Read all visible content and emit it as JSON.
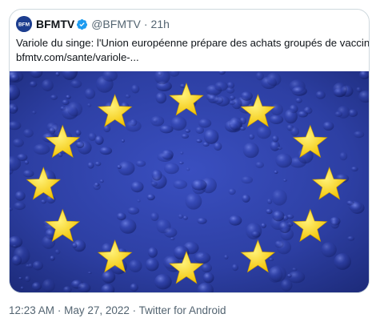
{
  "quote": {
    "display_name": "BFMTV",
    "handle": "@BFMTV",
    "separator": "·",
    "time": "21h",
    "text_line1": "Variole du singe: l'Union européenne prépare des achats groupés de vaccins",
    "text_line2": "bfmtv.com/sante/variole-...",
    "avatar_text": "BFM",
    "image": {
      "subject": "eu-flag-with-water-droplets",
      "star_count": 12,
      "star_color": "#ffd91a",
      "field_color": "#2d3fa3"
    }
  },
  "footer": {
    "time": "12:23 AM",
    "dot1": "·",
    "date": "May 27, 2022",
    "dot2": "·",
    "client": "Twitter for Android"
  },
  "colors": {
    "border": "#cfd9de",
    "muted": "#536471",
    "verified": "#1d9bf0"
  }
}
